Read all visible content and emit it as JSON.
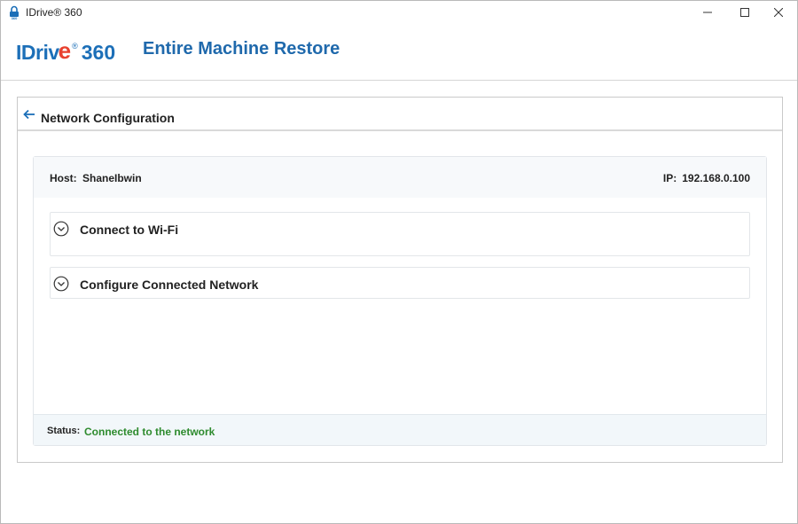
{
  "window": {
    "title": "IDrive® 360",
    "icon": "idrive-lock-icon"
  },
  "header": {
    "logo_idrive": "IDriv",
    "logo_e": "e",
    "logo_reg": "®",
    "logo_360": "360",
    "title": "Entire Machine Restore"
  },
  "panel": {
    "title": "Network Configuration"
  },
  "host": {
    "host_label": "Host:",
    "host_value": "ShaneIbwin",
    "ip_label": "IP:",
    "ip_value": "192.168.0.100"
  },
  "sections": [
    {
      "label": "Connect to Wi-Fi",
      "icon": "chevron-down-circle-icon"
    },
    {
      "label": "Configure Connected Network",
      "icon": "chevron-down-circle-icon"
    }
  ],
  "status": {
    "label": "Status:",
    "value": "Connected to the network",
    "color": "#2e8b2e"
  },
  "colors": {
    "brand_blue": "#1c6fb8",
    "brand_red": "#e8412f",
    "title_blue": "#1f69ac"
  }
}
